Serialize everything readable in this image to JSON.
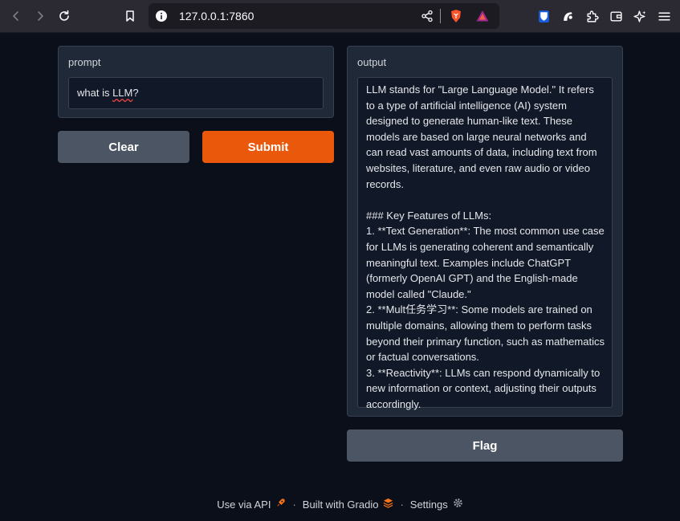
{
  "browser": {
    "url": "127.0.0.1:7860",
    "icons": [
      "back-icon",
      "forward-icon",
      "reload-icon",
      "bookmark-icon",
      "site-info-icon",
      "share-icon",
      "brave-shields-icon",
      "brave-rewards-icon",
      "bitwarden-icon",
      "extension-icon",
      "puzzle-icon",
      "wallet-icon",
      "leo-icon",
      "menu-icon"
    ]
  },
  "prompt": {
    "label": "prompt",
    "value_before": "what is ",
    "value_misspelled": "LLM",
    "value_after": "?"
  },
  "buttons": {
    "clear": "Clear",
    "submit": "Submit",
    "flag": "Flag"
  },
  "output": {
    "label": "output",
    "text": "LLM stands for \"Large Language Model.\" It refers to a type of artificial intelligence (AI) system designed to generate human-like text. These models are based on large neural networks and can read vast amounts of data, including text from websites, literature, and even raw audio or video records.\n\n### Key Features of LLMs:\n1. **Text Generation**: The most common use case for LLMs is generating coherent and semantically meaningful text. Examples include ChatGPT (formerly OpenAI GPT) and the English-made model called \"Claude.\"\n2. **Mult任务学习**: Some models are trained on multiple domains, allowing them to perform tasks beyond their primary function, such as mathematics or factual conversations.\n3. **Reactivity**: LLMs can respond dynamically to new information or context, adjusting their outputs accordingly."
  },
  "footer": {
    "api": "Use via API",
    "built": "Built with Gradio",
    "settings": "Settings",
    "sep": "·"
  },
  "colors": {
    "background": "#0b0f19",
    "panel": "#1f2937",
    "accent": "#ea580c",
    "secondary_button": "#4b5563"
  }
}
